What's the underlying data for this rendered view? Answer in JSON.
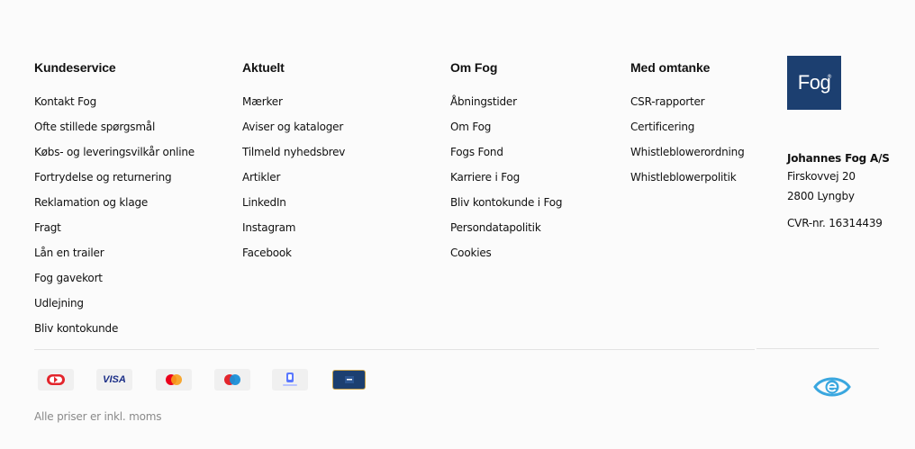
{
  "columns": [
    {
      "title": "Kundeservice",
      "links": [
        "Kontakt Fog",
        "Ofte stillede spørgsmål",
        "Købs- og leveringsvilkår online",
        "Fortrydelse og returnering",
        "Reklamation og klage",
        "Fragt",
        "Lån en trailer",
        "Fog gavekort",
        "Udlejning",
        "Bliv kontokunde"
      ]
    },
    {
      "title": "Aktuelt",
      "links": [
        "Mærker",
        "Aviser og kataloger",
        "Tilmeld nyhedsbrev",
        "Artikler",
        "LinkedIn",
        "Instagram",
        "Facebook"
      ]
    },
    {
      "title": "Om Fog",
      "links": [
        "Åbningstider",
        "Om Fog",
        "Fogs Fond",
        "Karriere i Fog",
        "Bliv kontokunde i Fog",
        "Persondatapolitik",
        "Cookies"
      ]
    },
    {
      "title": "Med omtanke",
      "links": [
        "CSR-rapporter",
        "Certificering",
        "Whistleblowerordning",
        "Whistleblowerpolitik"
      ]
    }
  ],
  "logo": {
    "text": "Fog",
    "mark": "®",
    "bg_color": "#1c3f70"
  },
  "company": {
    "name": "Johannes Fog A/S",
    "street": "Firskovvej 20",
    "city": "2800 Lyngby",
    "cvr": "CVR-nr. 16314439"
  },
  "payments": [
    {
      "icon": "dankort-icon"
    },
    {
      "icon": "visa-icon",
      "label": "VISA"
    },
    {
      "icon": "mastercard-icon"
    },
    {
      "icon": "maestro-icon"
    },
    {
      "icon": "mobilepay-icon"
    },
    {
      "icon": "fog-giftcard-icon"
    }
  ],
  "footnote": "Alle priser er inkl. moms",
  "colors": {
    "brand_blue": "#1c3f70",
    "emark_blue": "#3aa7df"
  }
}
